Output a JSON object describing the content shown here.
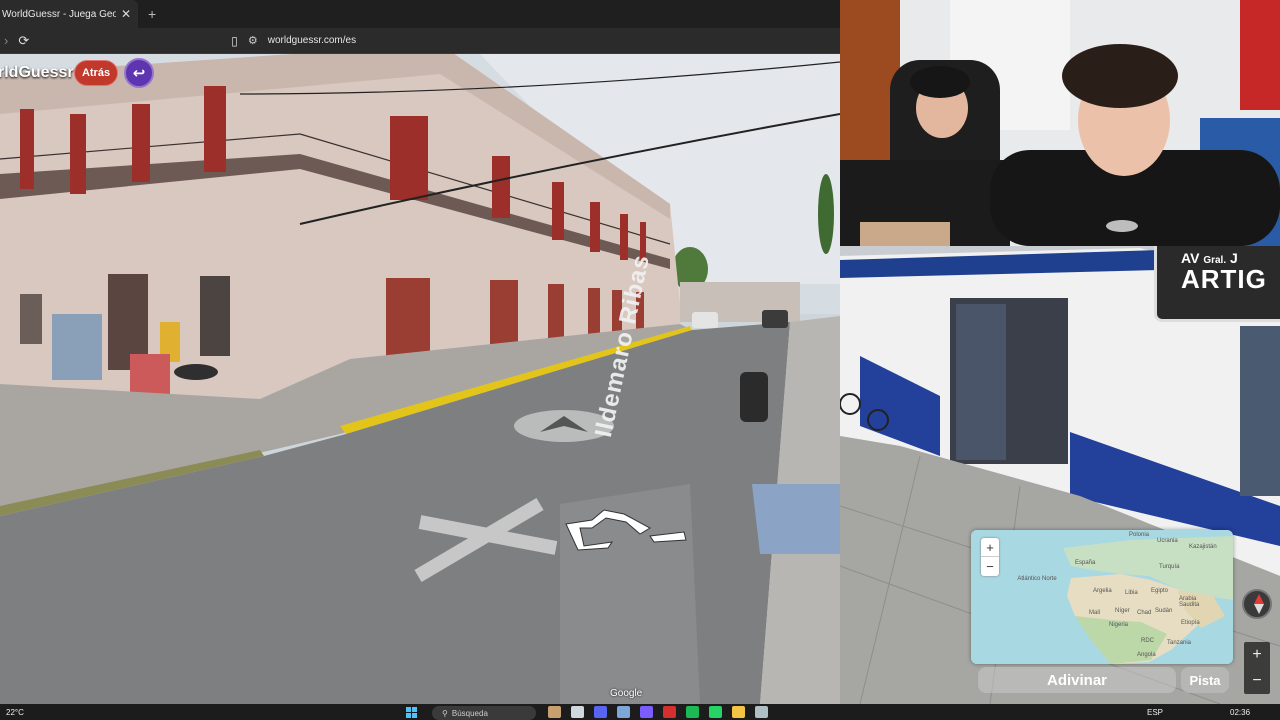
{
  "browser": {
    "tab_title": "WorldGuessr - Juega GeoGuessr",
    "tab_close": "✕",
    "new_tab": "+",
    "url": "worldguessr.com/es"
  },
  "game": {
    "logo_text": "rldGuessr",
    "back_label": "Atrás",
    "return_icon": "↩",
    "street_name": "Ildemaro Ribas",
    "google_watermark": "Google",
    "guess_label": "Adivinar",
    "hint_label": "Pista",
    "map_zoom_in": "+",
    "map_zoom_out": "−",
    "sv_zoom_in": "+",
    "sv_zoom_out": "−"
  },
  "sign": {
    "line1_prefix": "AV",
    "line1_small": "Gral.",
    "line1_suffix": "J",
    "line2": "ARTIG"
  },
  "map_labels": {
    "polonia": "Polonia",
    "ucrania": "Ucrania",
    "kazajistan": "Kazajistán",
    "espana": "España",
    "turquia": "Turquía",
    "atlantico": "Atlántico Norte",
    "argelia": "Argelia",
    "libia": "Libia",
    "egipto": "Egipto",
    "arabia": "Arabia Saudita",
    "mali": "Malí",
    "niger": "Níger",
    "chad": "Chad",
    "sudan": "Sudán",
    "nigeria": "Nigeria",
    "etiopia": "Etiopía",
    "rdc": "RDC",
    "tanzania": "Tanzania",
    "angola": "Angola"
  },
  "taskbar": {
    "temperature": "22°C",
    "search_placeholder": "Búsqueda",
    "language": "ESP",
    "time": "02:36"
  }
}
